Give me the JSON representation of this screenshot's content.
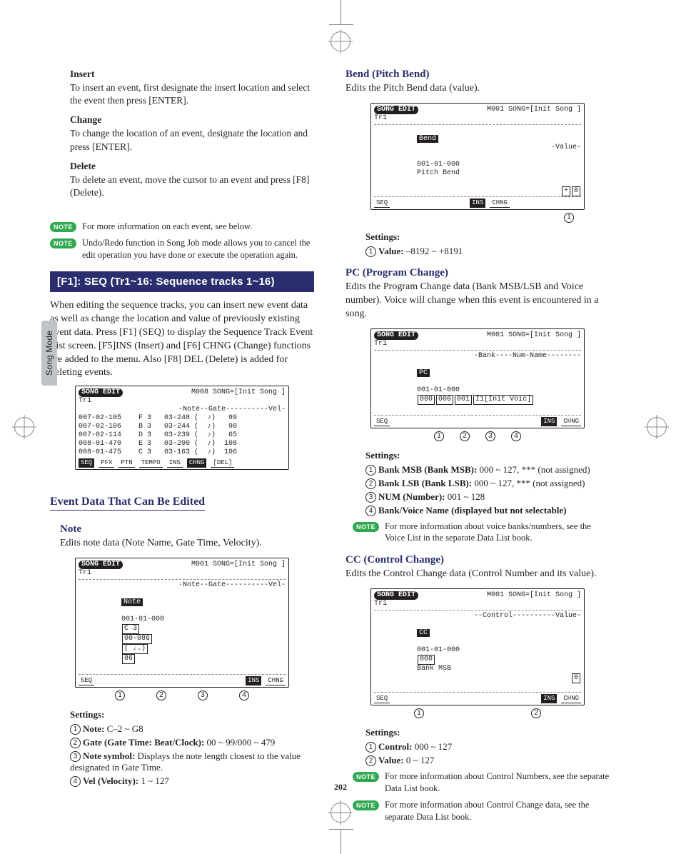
{
  "page_number": "202",
  "sidebar_tab": "Song Mode",
  "left": {
    "insert": {
      "heading": "Insert",
      "body": "To insert an event, first designate the insert location and select the event then press [ENTER]."
    },
    "change": {
      "heading": "Change",
      "body": "To change the location of an event, designate the location and press [ENTER]."
    },
    "delete": {
      "heading": "Delete",
      "body": "To delete an event, move the cursor to an event and press [F8] (Delete)."
    },
    "note_badge": "NOTE",
    "note1": "For more information on each event, see below.",
    "note2": "Undo/Redo function in Song Job mode allows you to cancel the edit operation you have done or execute the operation again.",
    "f1_bar": "[F1]: SEQ (Tr1~16: Sequence tracks 1~16)",
    "seq_body": "When editing the sequence tracks, you can insert new event data as well as change the location and value of previously existing event data. Press [F1] (SEQ) to display the Sequence Track Event List screen. [F5]INS (Insert) and [F6] CHNG (Change) functions are added to the menu. Also [F8] DEL (Delete) is added for deleting events.",
    "seq_lcd": {
      "title_tab": "SONG EDIT",
      "title_right": "M008 SONG=[Init Song ]",
      "line_tr": "Tr1",
      "hdr": "-Note--Gate----------Vel-",
      "rows": [
        "007-02-105    F 3   03-248 (  ♪)   99",
        "007-02-106    B 3   03-244 (  ♪)   90",
        "007-02-114    D 3   03-239 (  ♪)   65",
        "008-01-470    E 3   03-200 (  ♪)  108",
        "008-01-475    C 3   03-163 (  ♪)  106"
      ],
      "tabs": [
        "SEQ",
        "PFX",
        "PTN",
        "TEMPO",
        "INS",
        "CHNG",
        "[DEL]"
      ]
    },
    "edit_heading": "Event Data That Can Be Edited",
    "note_section": {
      "heading": "Note",
      "body": "Edits note data (Note Name, Gate Time, Velocity).",
      "lcd": {
        "title_tab": "SONG EDIT",
        "title_right": "M001 SONG=[Init Song ]",
        "line_tr": "Tr1",
        "hdr": "-Note--Gate----------Vel-",
        "field_label": "Note",
        "loc": "001-01-000",
        "note_val": "C 3",
        "gate_val": "00-086",
        "sym_val": "( ♩.)",
        "vel_val": "86",
        "tabs": [
          "SEQ",
          "INS",
          "CHNG"
        ]
      },
      "callouts": [
        "1",
        "2",
        "3",
        "4"
      ],
      "settings_label": "Settings:",
      "settings": [
        {
          "n": "1",
          "label": "Note:",
          "value": "C–2 ~ G8"
        },
        {
          "n": "2",
          "label": "Gate (Gate Time: Beat/Clock):",
          "value": "00 ~ 99/000 ~ 479"
        },
        {
          "n": "3",
          "label": "Note symbol:",
          "value": "Displays the note length closest to the value designated in Gate Time."
        },
        {
          "n": "4",
          "label": "Vel (Velocity):",
          "value": "1 ~ 127"
        }
      ]
    }
  },
  "right": {
    "bend": {
      "heading": "Bend (Pitch Bend)",
      "body": "Edits the Pitch Bend data (value).",
      "lcd": {
        "title_tab": "SONG EDIT",
        "title_right": "M001 SONG=[Init Song ]",
        "line_tr": "Tr1",
        "field_label": "Bend",
        "loc": "001-01-000",
        "mid": "Pitch Bend",
        "val_hdr": "-Value-",
        "sign": "+",
        "val": "0",
        "tabs": [
          "SEQ",
          "INS",
          "CHNG"
        ]
      },
      "callouts": [
        "1"
      ],
      "settings_label": "Settings:",
      "settings": [
        {
          "n": "1",
          "label": "Value:",
          "value": "–8192 ~ +8191"
        }
      ]
    },
    "pc": {
      "heading": "PC (Program Change)",
      "body": "Edits the Program Change data (Bank MSB/LSB and Voice number). Voice will change when this event is encountered in a song.",
      "lcd": {
        "title_tab": "SONG EDIT",
        "title_right": "M001 SONG=[Init Song ]",
        "line_tr": "Tr1",
        "field_label": "PC",
        "loc": "001-01-000",
        "hdr": "-Bank----Num-Name--------",
        "msb": "000",
        "lsb": "000",
        "num": "001",
        "name": "I1[Init Voic]",
        "tabs": [
          "SEQ",
          "INS",
          "CHNG"
        ]
      },
      "callouts": [
        "1",
        "2",
        "3",
        "4"
      ],
      "settings_label": "Settings:",
      "settings": [
        {
          "n": "1",
          "label": "Bank MSB (Bank MSB):",
          "value": "000 ~ 127, *** (not assigned)"
        },
        {
          "n": "2",
          "label": "Bank LSB (Bank LSB):",
          "value": "000 ~ 127, *** (not assigned)"
        },
        {
          "n": "3",
          "label": "NUM (Number):",
          "value": "001 ~ 128"
        },
        {
          "n": "4",
          "label": "Bank/Voice Name (displayed but not selectable)",
          "value": ""
        }
      ],
      "note": "For more information about voice banks/numbers, see the Voice List in the separate Data List book."
    },
    "cc": {
      "heading": "CC (Control Change)",
      "body": "Edits the Control Change data (Control Number and its value).",
      "lcd": {
        "title_tab": "SONG EDIT",
        "title_right": "M001 SONG=[Init Song ]",
        "line_tr": "Tr1",
        "field_label": "CC",
        "loc": "001-01-000",
        "hdr": "--Control----------Value-",
        "ctrl_num": "000",
        "ctrl_name": "Bank MSB",
        "val": "0",
        "tabs": [
          "SEQ",
          "INS",
          "CHNG"
        ]
      },
      "callouts": [
        "1",
        "2"
      ],
      "settings_label": "Settings:",
      "settings": [
        {
          "n": "1",
          "label": "Control:",
          "value": "000 ~ 127"
        },
        {
          "n": "2",
          "label": "Value:",
          "value": "0 ~ 127"
        }
      ],
      "note1": "For more information about Control Numbers, see the separate Data List book.",
      "note2": "For more information about Control Change data, see the separate Data List book."
    }
  }
}
